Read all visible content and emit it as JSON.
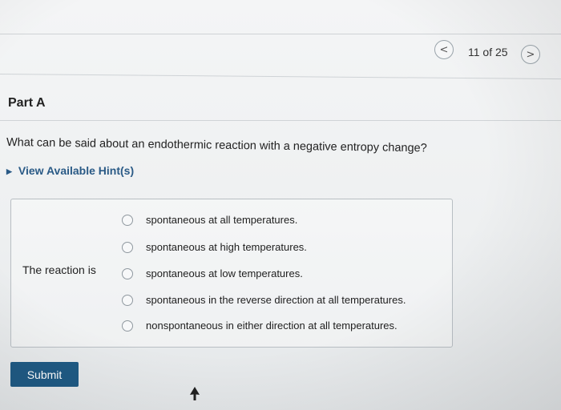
{
  "navigation": {
    "prev_label": "<",
    "counter": "11 of 25",
    "next_label": ">"
  },
  "part": {
    "title": "Part A"
  },
  "question": {
    "text": "What can be said about an endothermic reaction with a negative entropy change?",
    "hint_label": "View Available Hint(s)"
  },
  "answer": {
    "stem": "The reaction is",
    "options": [
      {
        "label": "spontaneous at all temperatures."
      },
      {
        "label": "spontaneous at high temperatures."
      },
      {
        "label": "spontaneous at low temperatures."
      },
      {
        "label": "spontaneous in the reverse direction at all temperatures."
      },
      {
        "label": "nonspontaneous in either direction at all temperatures."
      }
    ]
  },
  "submit": {
    "label": "Submit"
  },
  "colors": {
    "link": "#2a5a86",
    "button": "#1f5a84"
  }
}
